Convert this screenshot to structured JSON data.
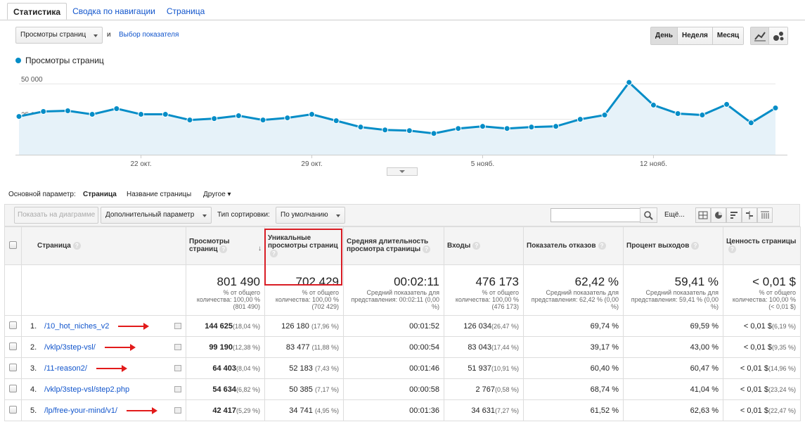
{
  "tabs": [
    "Статистика",
    "Сводка по навигации",
    "Страница"
  ],
  "metric": {
    "selected": "Просмотры страниц",
    "and": "и",
    "choose_link": "Выбор показателя"
  },
  "period_buttons": [
    "День",
    "Неделя",
    "Месяц"
  ],
  "chart_data": {
    "type": "line",
    "legend": "Просмотры страниц",
    "y_ticks": [
      "50 000",
      "25 000"
    ],
    "x_ticks": [
      "22 окт.",
      "29 окт.",
      "5 нояб.",
      "12 нояб."
    ],
    "ylim": [
      0,
      62000
    ],
    "series": [
      {
        "name": "Просмотры страниц",
        "color": "#058dc7",
        "values": [
          27000,
          30500,
          31000,
          28500,
          32500,
          28500,
          28500,
          24500,
          25500,
          27500,
          24500,
          26000,
          28500,
          24000,
          19500,
          17500,
          17000,
          15000,
          18500,
          20000,
          18500,
          19500,
          20000,
          25000,
          28000,
          51000,
          35000,
          29000,
          28000,
          35500,
          22500,
          33000
        ]
      }
    ]
  },
  "dims": {
    "primary_label": "Основной параметр:",
    "primary": "Страница",
    "page_title": "Название страницы",
    "other": "Другое"
  },
  "controls": {
    "plot_rows": "Показать на диаграмме",
    "secondary": "Дополнительный параметр",
    "sort_label": "Тип сортировки:",
    "sort_value": "По умолчанию",
    "more": "Ещё..."
  },
  "headers": {
    "page": "Страница",
    "pageviews": "Просмотры страниц",
    "unique": "Уникальные просмотры страниц",
    "avg_time": "Средняя длительность просмотра страницы",
    "entrances": "Входы",
    "bounce": "Показатель отказов",
    "exit": "Процент выходов",
    "value": "Ценность страницы"
  },
  "totals": {
    "pageviews": "801 490",
    "pageviews_sub": "% от общего количества: 100,00 % (801 490)",
    "unique": "702 429",
    "unique_sub": "% от общего количества: 100,00 % (702 429)",
    "avg_time": "00:02:11",
    "avg_time_sub": "Средний показатель для представления: 00:02:11 (0,00 %)",
    "entrances": "476 173",
    "entrances_sub": "% от общего количества: 100,00 % (476 173)",
    "bounce": "62,42 %",
    "bounce_sub": "Средний показатель для представления: 62,42 % (0,00 %)",
    "exit": "59,41 %",
    "exit_sub": "Средний показатель для представления: 59,41 % (0,00 %)",
    "value": "< 0,01 $",
    "value_sub": "% от общего количества: 100,00 % (< 0,01 $)"
  },
  "rows": [
    {
      "n": "1.",
      "page": "/10_hot_niches_v2",
      "pv": "144 625",
      "pv_pct": "(18,04 %)",
      "u": "126 180",
      "u_pct": "(17,96 %)",
      "t": "00:01:52",
      "e": "126 034",
      "e_pct": "(26,47 %)",
      "b": "69,74 %",
      "x": "69,59 %",
      "v": "< 0,01 $",
      "v_pct": "(6,19 %)"
    },
    {
      "n": "2.",
      "page": "/vklp/3step-vsl/",
      "pv": "99 190",
      "pv_pct": "(12,38 %)",
      "u": "83 477",
      "u_pct": "(11,88 %)",
      "t": "00:00:54",
      "e": "83 043",
      "e_pct": "(17,44 %)",
      "b": "39,17 %",
      "x": "43,00 %",
      "v": "< 0,01 $",
      "v_pct": "(9,35 %)"
    },
    {
      "n": "3.",
      "page": "/11-reason2/",
      "pv": "64 403",
      "pv_pct": "(8,04 %)",
      "u": "52 183",
      "u_pct": "(7,43 %)",
      "t": "00:01:46",
      "e": "51 937",
      "e_pct": "(10,91 %)",
      "b": "60,40 %",
      "x": "60,47 %",
      "v": "< 0,01 $",
      "v_pct": "(14,96 %)"
    },
    {
      "n": "4.",
      "page": "/vklp/3step-vsl/step2.php",
      "pv": "54 634",
      "pv_pct": "(6,82 %)",
      "u": "50 385",
      "u_pct": "(7,17 %)",
      "t": "00:00:58",
      "e": "2 767",
      "e_pct": "(0,58 %)",
      "b": "68,74 %",
      "x": "41,04 %",
      "v": "< 0,01 $",
      "v_pct": "(23,24 %)"
    },
    {
      "n": "5.",
      "page": "/lp/free-your-mind/v1/",
      "pv": "42 417",
      "pv_pct": "(5,29 %)",
      "u": "34 741",
      "u_pct": "(4,95 %)",
      "t": "00:01:36",
      "e": "34 631",
      "e_pct": "(7,27 %)",
      "b": "61,52 %",
      "x": "62,63 %",
      "v": "< 0,01 $",
      "v_pct": "(22,47 %)"
    }
  ],
  "arrows": [
    true,
    true,
    true,
    false,
    true
  ]
}
